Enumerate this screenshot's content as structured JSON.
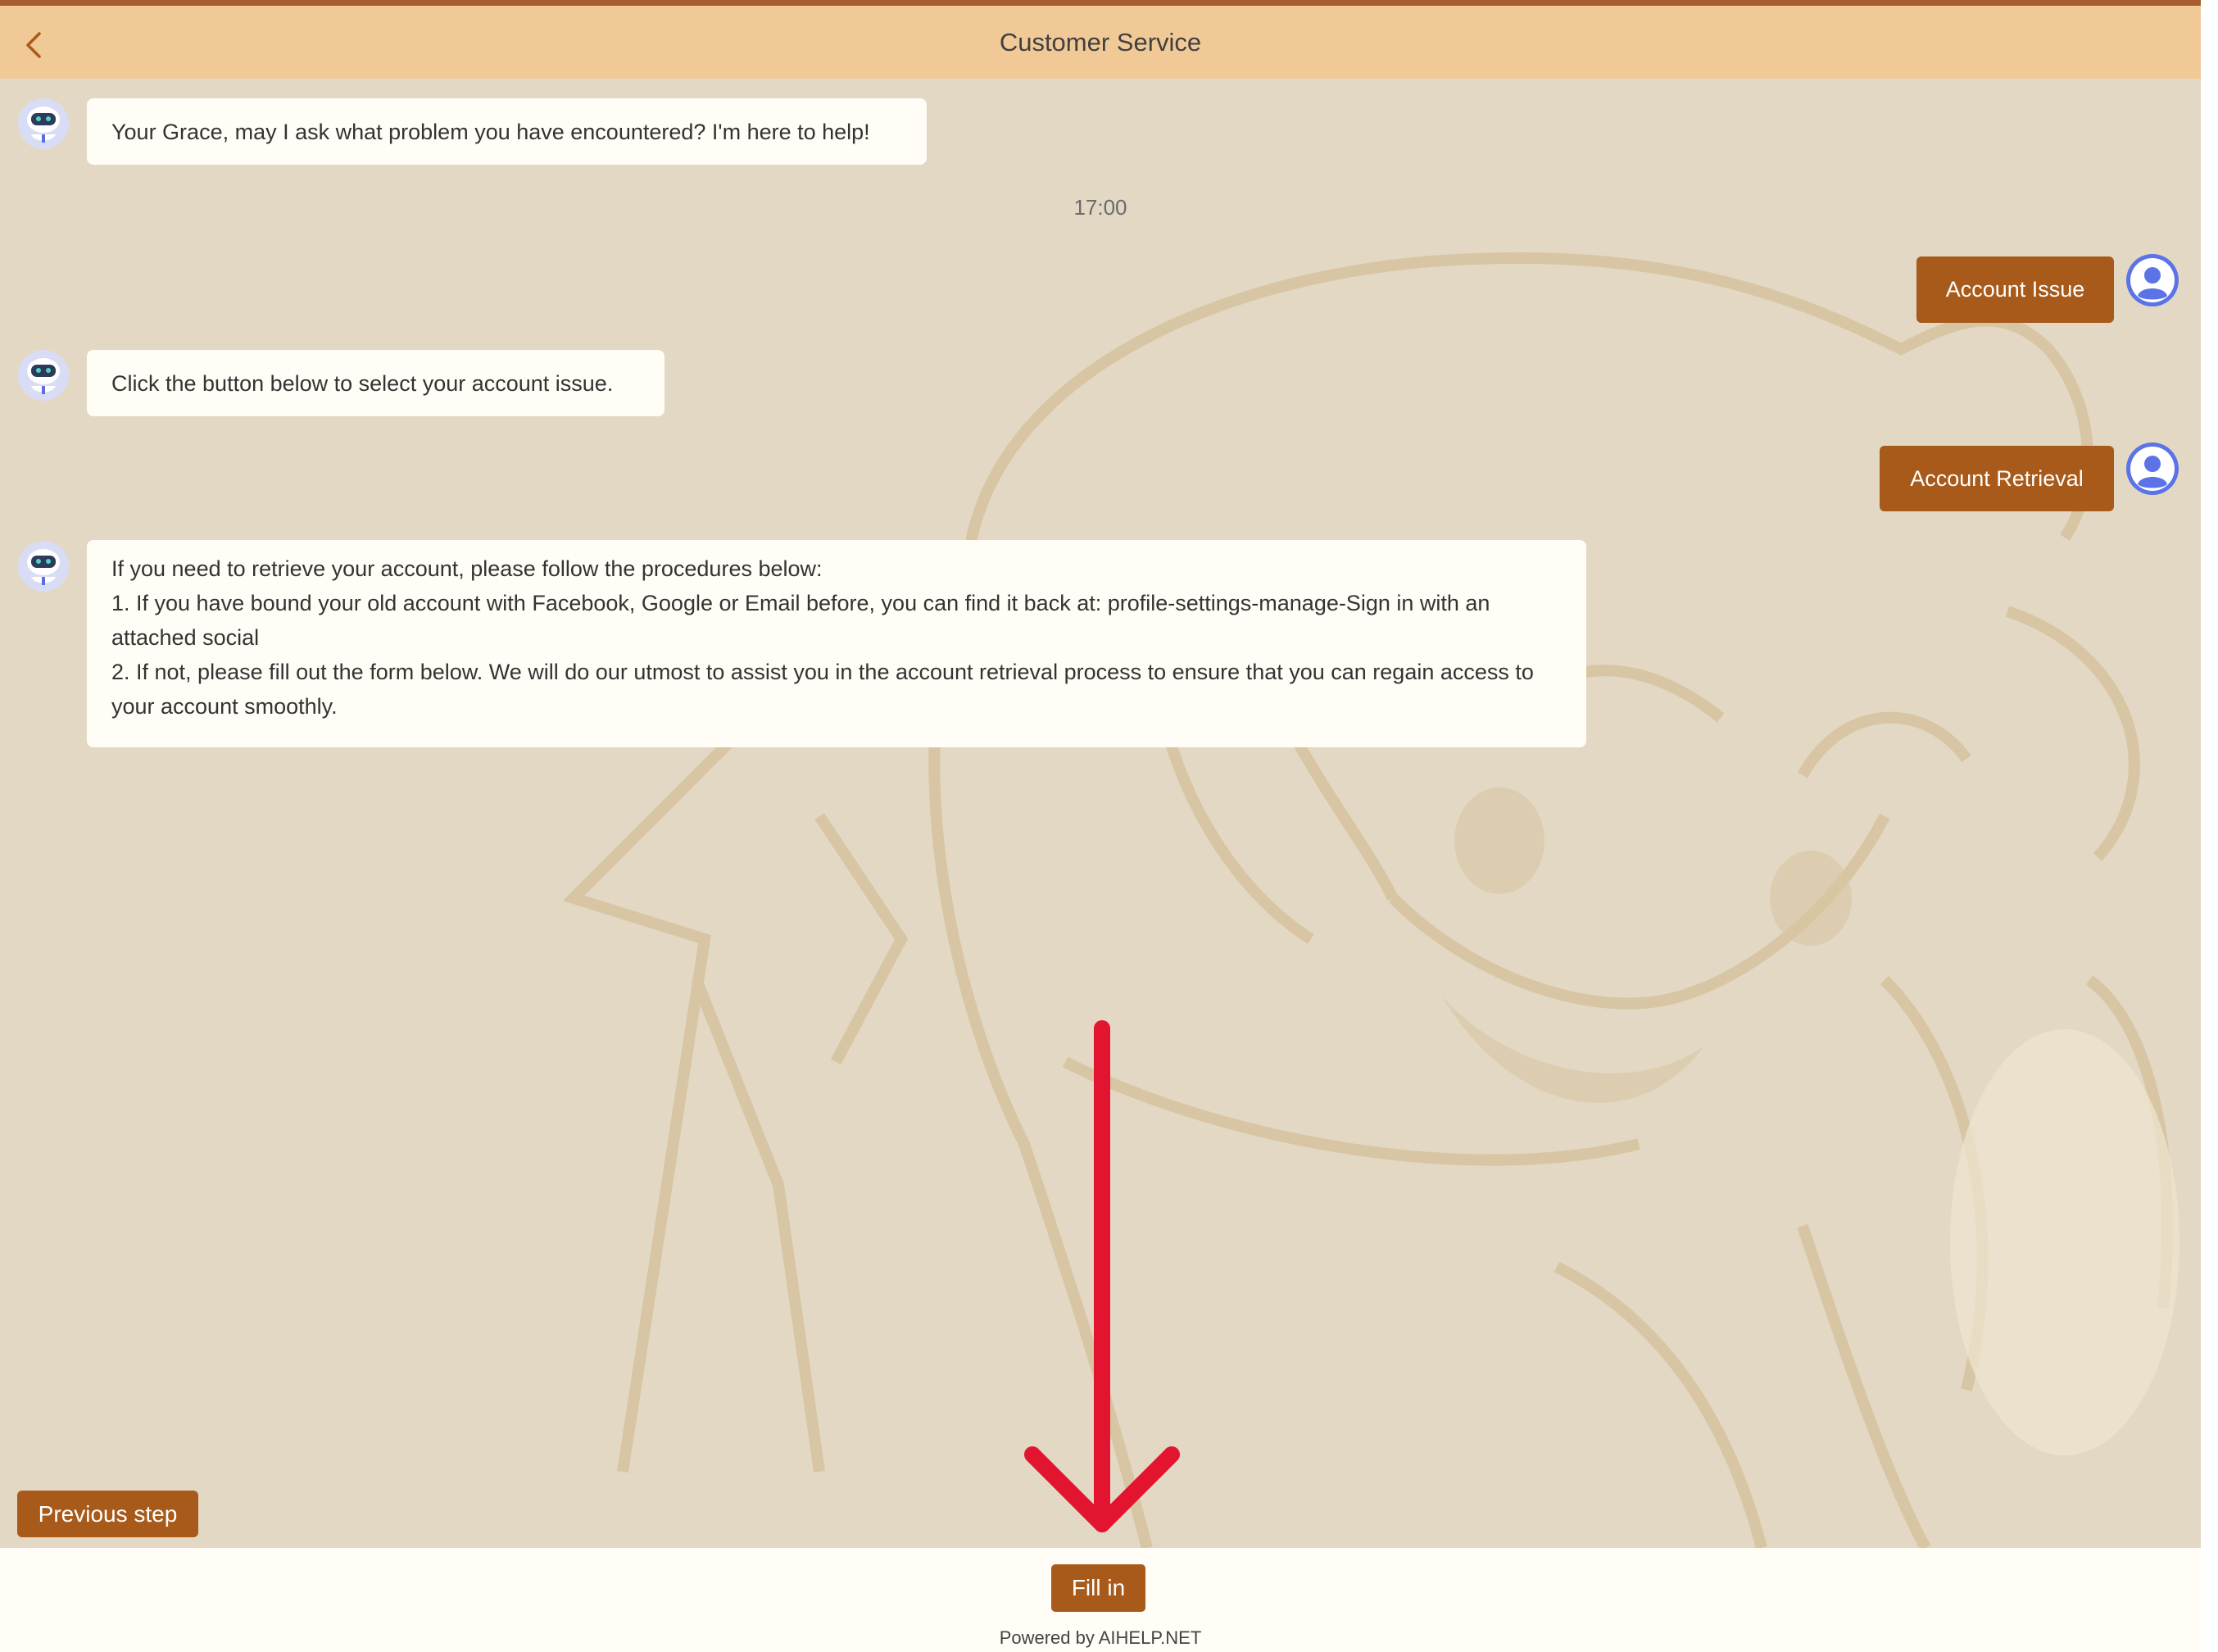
{
  "header": {
    "title": "Customer Service",
    "back_icon": "chevron-left-icon"
  },
  "colors": {
    "header_bg": "#f1c997",
    "accent": "#a85a1a",
    "chat_bg": "#e3d8c4",
    "bubble_bg": "#fffdf6",
    "arrow": "#e3142f"
  },
  "messages": [
    {
      "sender": "bot",
      "text": "Your Grace, may I ask what problem you have encountered? I'm here to help!"
    },
    {
      "sender": "user",
      "text": "Account Issue"
    },
    {
      "sender": "bot",
      "text": "Click the button below to select your account issue."
    },
    {
      "sender": "user",
      "text": "Account Retrieval"
    },
    {
      "sender": "bot",
      "lines": [
        "If you need to retrieve your account, please follow the procedures below:",
        "1. If you have bound your old account with Facebook, Google or Email before, you can find it back at: profile-settings-manage-Sign in with an attached social",
        "2. If not, please fill out the form below. We will do our utmost to assist you in the account retrieval process to ensure that you can regain access to your account smoothly."
      ]
    }
  ],
  "timestamp": "17:00",
  "actions": {
    "previous_step": "Previous step",
    "fill_in": "Fill in"
  },
  "footer": {
    "powered_by": "Powered by AIHELP.NET"
  }
}
